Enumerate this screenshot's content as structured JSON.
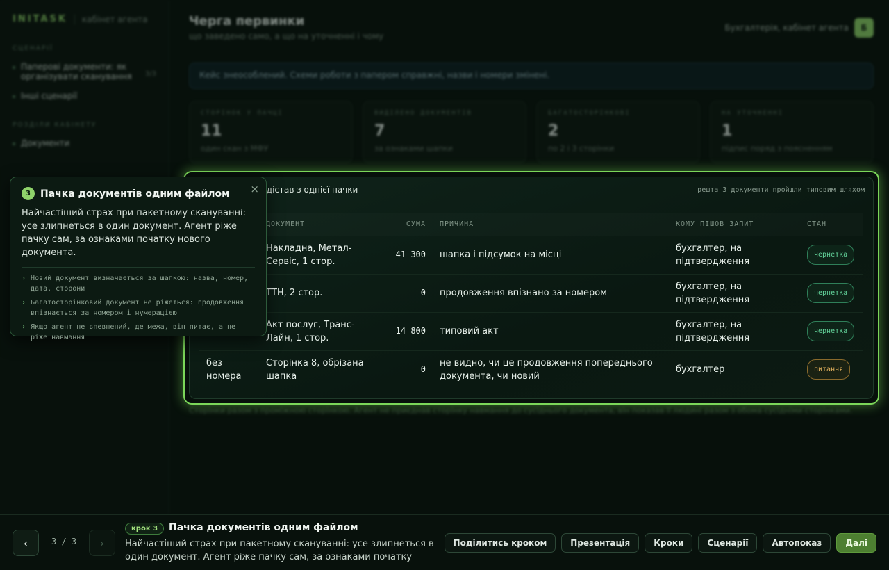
{
  "brand": {
    "logo": "INITASK",
    "subtitle": "кабінет агента"
  },
  "sidebar": {
    "section_scenarios": "СЦЕНАРІЇ",
    "scenarios": [
      {
        "label": "Паперові документи: як організувати сканування",
        "count": "3/3"
      },
      {
        "label": "Інші сценарії"
      }
    ],
    "section_cabinet": "РОЗДІЛИ КАБІНЕТУ",
    "cabinet": [
      {
        "label": "Документи"
      }
    ]
  },
  "header": {
    "title": "Черга первинки",
    "subtitle": "що заведено само, а що на уточненні і чому",
    "account": "Бухгалтерія, кабінет агента",
    "avatar": "Б"
  },
  "notice": "Кейс знеособлений. Схеми роботи з папером справжні, назви і номери змінені.",
  "stats": [
    {
      "label": "СТОРІНОК У ПАЧЦІ",
      "value": "11",
      "hint": "один скан з МФУ"
    },
    {
      "label": "ВИДІЛЕНО ДОКУМЕНТІВ",
      "value": "7",
      "hint": "за ознаками шапки"
    },
    {
      "label": "БАГАТОСТОРІНКОВІ",
      "value": "2",
      "hint": "по 2 і 3 сторінки"
    },
    {
      "label": "НА УТОЧНЕННІ",
      "value": "1",
      "hint": "підпис поряд з поясненням"
    }
  ],
  "footnote": "Сторінки разом з проміжною сторінкою. Агент не приєднав сторінку навмання до сусіднього документа, він показав її людині разом з обома сусідніми сторінками.",
  "card": {
    "title": "т дістав з однієї пачки",
    "meta": "решта 3 документи пройшли типовим шляхом",
    "columns": {
      "document": "ДОКУМЕНТ",
      "amount": "СУМА",
      "reason": "ПРИЧИНА",
      "request": "КОМУ ПІШОВ ЗАПИТ",
      "state": "СТАН"
    },
    "rows": [
      {
        "page": "",
        "document": "Накладна, Метал-Сервіс, 1 стор.",
        "amount": "41 300",
        "reason": "шапка і підсумок на місці",
        "request": "бухгалтер, на підтвердження",
        "state": "чернетка"
      },
      {
        "page": "",
        "document": "ТТН, 2 стор.",
        "amount": "0",
        "reason": "продовження впізнано за номером",
        "request": "бухгалтер, на підтвердження",
        "state": "чернетка"
      },
      {
        "page": "",
        "document": "Акт послуг, Транс-Лайн, 1 стор.",
        "amount": "14 800",
        "reason": "типовий акт",
        "request": "бухгалтер, на підтвердження",
        "state": "чернетка"
      },
      {
        "page": "без номера",
        "document": "Сторінка 8, обрізана шапка",
        "amount": "0",
        "reason": "не видно, чи це продовження попереднього документа, чи новий",
        "request": "бухгалтер",
        "state": "питання"
      }
    ]
  },
  "popover": {
    "number": "3",
    "title": "Пачка документів одним файлом",
    "close": "×",
    "body": "Найчастіший страх при пакетному скануванні: усе злипнеться в один документ. Агент ріже пачку сам, за ознаками початку нового документа.",
    "points": [
      "Новий документ визначається за шапкою: назва, номер, дата, сторони",
      "Багатосторінковий документ не ріжеться: продовження впізнається за номером і нумерацією",
      "Якщо агент не впевнений, де межа, він питає, а не ріже навмання"
    ]
  },
  "bottombar": {
    "prev": "‹",
    "next": "›",
    "counter": "3 / 3",
    "step_tag": "крок 3",
    "title": "Пачка документів одним файлом",
    "desc": "Найчастіший страх при пакетному скануванні: усе злипнеться в один документ. Агент ріже пачку сам, за ознаками початку ново…",
    "actions": {
      "share": "Поділитись кроком",
      "presentation": "Презентація",
      "steps": "Кроки",
      "scenarios": "Сценарії",
      "autoplay": "Автопоказ",
      "next": "Далі"
    }
  }
}
